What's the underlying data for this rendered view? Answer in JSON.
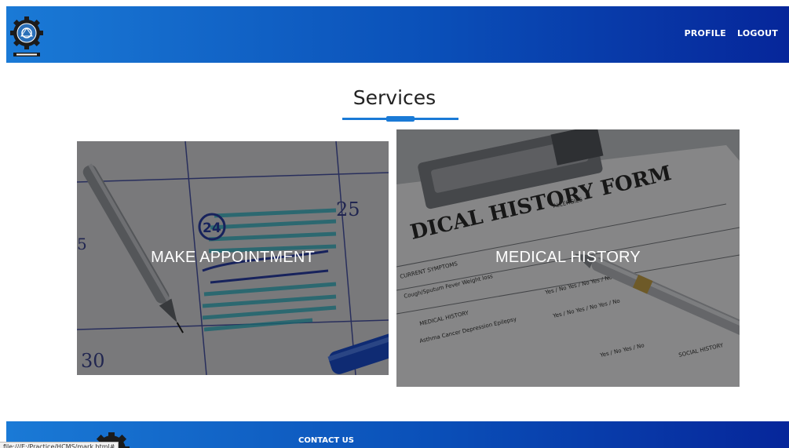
{
  "header": {
    "logo_icon": "gear-emblem-icon",
    "nav": [
      {
        "label": "PROFILE"
      },
      {
        "label": "LOGOUT"
      }
    ]
  },
  "services": {
    "title": "Services",
    "accent_color": "#1a7ad6",
    "cards": [
      {
        "label": "MAKE APPOINTMENT",
        "image": "calendar-appointment-image"
      },
      {
        "label": "MEDICAL HISTORY",
        "image": "medical-history-form-image"
      }
    ]
  },
  "footer": {
    "title": "CONTACT US",
    "logo_icon": "gear-emblem-icon"
  },
  "browser": {
    "status_url": "file:///E:/Practice/HCMS/mark.html#"
  }
}
